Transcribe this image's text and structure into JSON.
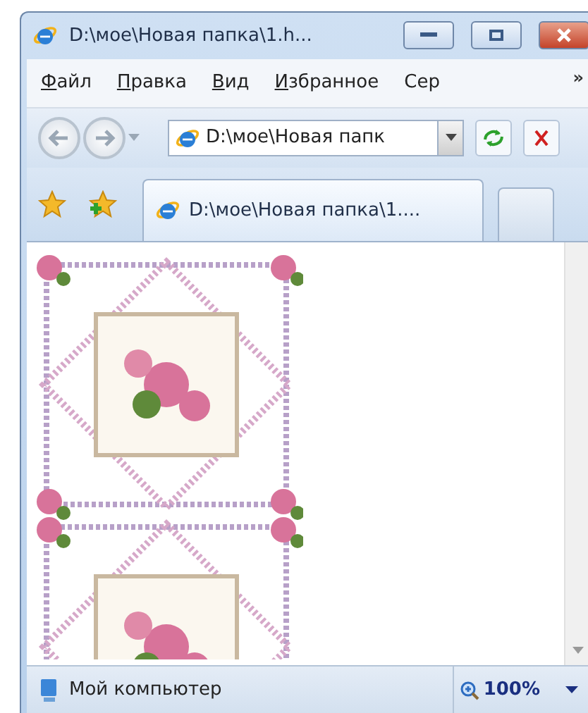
{
  "window": {
    "title": "D:\\мое\\Новая папка\\1.h..."
  },
  "menu": {
    "items": [
      {
        "label": "Файл",
        "underlined": true
      },
      {
        "label": "Правка",
        "underlined": true
      },
      {
        "label": "Вид",
        "underlined": true
      },
      {
        "label": "Избранное",
        "underlined": true
      },
      {
        "label": "Сер",
        "underlined": false
      }
    ],
    "more": "»"
  },
  "address": {
    "value": "D:\\мое\\Новая папк"
  },
  "tabs": [
    {
      "label": "D:\\мое\\Новая папка\\1....",
      "selected": true
    },
    {
      "selected": false
    }
  ],
  "status_bar": {
    "zone": "Мой компьютер",
    "zoom": "100%"
  }
}
